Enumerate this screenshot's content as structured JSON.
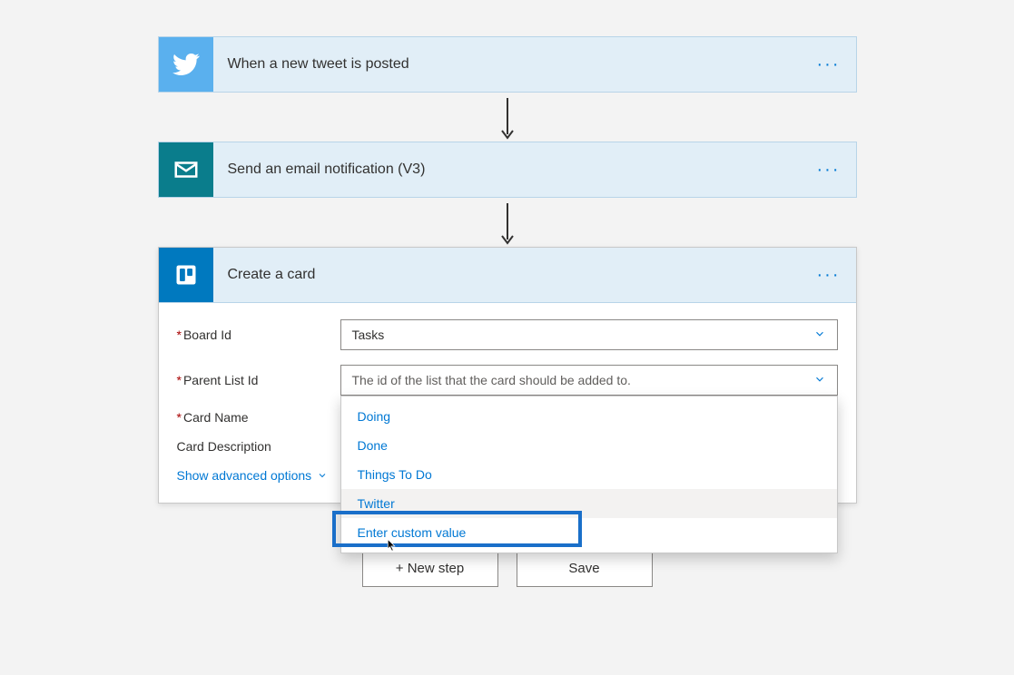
{
  "steps": {
    "trigger": {
      "title": "When a new tweet is posted"
    },
    "email": {
      "title": "Send an email notification (V3)"
    },
    "trello": {
      "title": "Create a card"
    }
  },
  "form": {
    "board_label": "Board Id",
    "board_value": "Tasks",
    "list_label": "Parent List Id",
    "list_placeholder": "The id of the list that the card should be added to.",
    "name_label": "Card Name",
    "desc_label": "Card Description",
    "advanced": "Show advanced options"
  },
  "dropdown": {
    "items": [
      "Doing",
      "Done",
      "Things To Do",
      "Twitter",
      "Enter custom value"
    ]
  },
  "footer": {
    "new_step": "+ New step",
    "save": "Save"
  },
  "colors": {
    "twitter": "#5ab0ee",
    "outlook": "#0a7d8c",
    "trello": "#0079bf"
  }
}
